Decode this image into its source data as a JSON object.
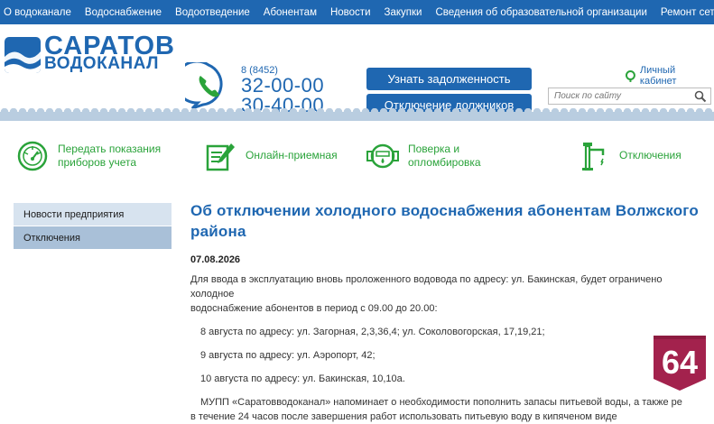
{
  "topnav": {
    "items": [
      "О водоканале",
      "Водоснабжение",
      "Водоотведение",
      "Абонентам",
      "Новости",
      "Закупки",
      "Сведения об образовательной организации",
      "Ремонт сетей"
    ]
  },
  "logo": {
    "line1": "САРАТОВ",
    "line2": "ВОДОКАНАЛ"
  },
  "phones": {
    "code": "8 (8452)",
    "number1": "32-00-00",
    "number2": "30-40-00"
  },
  "buttons": {
    "debt": "Узнать задолженность",
    "disconnect": "Отключение должников"
  },
  "cabinet": {
    "label": "Личный кабинет"
  },
  "search": {
    "placeholder": "Поиск по сайту"
  },
  "services": [
    {
      "line1": "Передать показания",
      "line2": "приборов учета"
    },
    {
      "line1": "Онлайн-приемная",
      "line2": ""
    },
    {
      "line1": "Поверка и",
      "line2": "опломбировка"
    },
    {
      "line1": "Отключения",
      "line2": ""
    }
  ],
  "sidebar": {
    "items": [
      "Новости предприятия",
      "Отключения"
    ]
  },
  "article": {
    "title_line1": "Об отключении холодного водоснабжения абонентам Волжского",
    "title_line2": "района",
    "date": "07.08.2026",
    "p1_line1": "Для ввода в эксплуатацию вновь проложенного водовода по адресу: ул. Бакинская, будет ограничено холодное",
    "p1_line2": "водоснабжение абонентов в период с 09.00 до 20.00:",
    "p2": "8 августа по адресу: ул. Загорная, 2,3,36,4; ул. Соколовогорская, 17,19,21;",
    "p3": "9 августа по адресу: ул. Аэропорт, 42;",
    "p4": "10 августа по адресу: ул. Бакинская, 10,10а.",
    "p5_line1": "МУПП «Саратовводоканал» напоминает о необходимости пополнить запасы питьевой воды, а также ре",
    "p5_line2": "в течение 24 часов после завершения работ использовать питьевую воду в кипяченом виде"
  },
  "badge": {
    "text": "64"
  },
  "colors": {
    "brand_blue": "#1f67b1",
    "green": "#2aa33a",
    "sidebar": "#d7e3ef",
    "sidebar_active": "#a9c0d8",
    "badge": "#a3224d"
  }
}
